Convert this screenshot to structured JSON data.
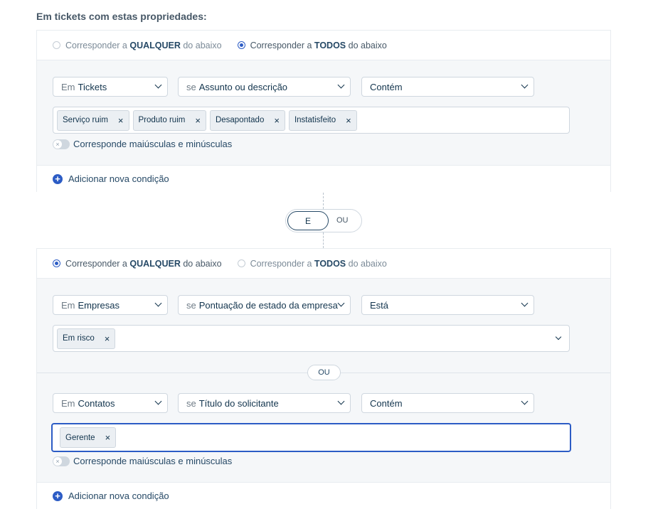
{
  "heading": "Em tickets com estas propriedades:",
  "group1": {
    "match_any": {
      "pre": "Corresponder a",
      "bold": "QUALQUER",
      "post": "do abaixo",
      "selected": false
    },
    "match_all": {
      "pre": "Corresponder a",
      "bold": "TODOS",
      "post": "do abaixo",
      "selected": true
    },
    "condition": {
      "entity_pre": "Em",
      "entity": "Tickets",
      "field_pre": "se",
      "field": "Assunto ou descrição",
      "operator": "Contém",
      "tags": [
        "Serviço ruim",
        "Produto ruim",
        "Desapontado",
        "Instatisfeito"
      ],
      "case_label": "Corresponde maiúsculas e minúsculas"
    },
    "add_label": "Adicionar nova condição"
  },
  "connector": {
    "and_label": "E",
    "or_label": "OU",
    "selected": "E"
  },
  "group2": {
    "match_any": {
      "pre": "Corresponder a",
      "bold": "QUALQUER",
      "post": "do abaixo",
      "selected": true
    },
    "match_all": {
      "pre": "Corresponder a",
      "bold": "TODOS",
      "post": "do abaixo",
      "selected": false
    },
    "condition1": {
      "entity_pre": "Em",
      "entity": "Empresas",
      "field_pre": "se",
      "field": "Pontuação de estado da empresa",
      "operator": "Está",
      "tags": [
        "Em risco"
      ]
    },
    "or_label": "OU",
    "condition2": {
      "entity_pre": "Em",
      "entity": "Contatos",
      "field_pre": "se",
      "field": "Título do solicitante",
      "operator": "Contém",
      "tags": [
        "Gerente"
      ],
      "case_label": "Corresponde maiúsculas e minúsculas"
    },
    "add_label": "Adicionar nova condição"
  }
}
